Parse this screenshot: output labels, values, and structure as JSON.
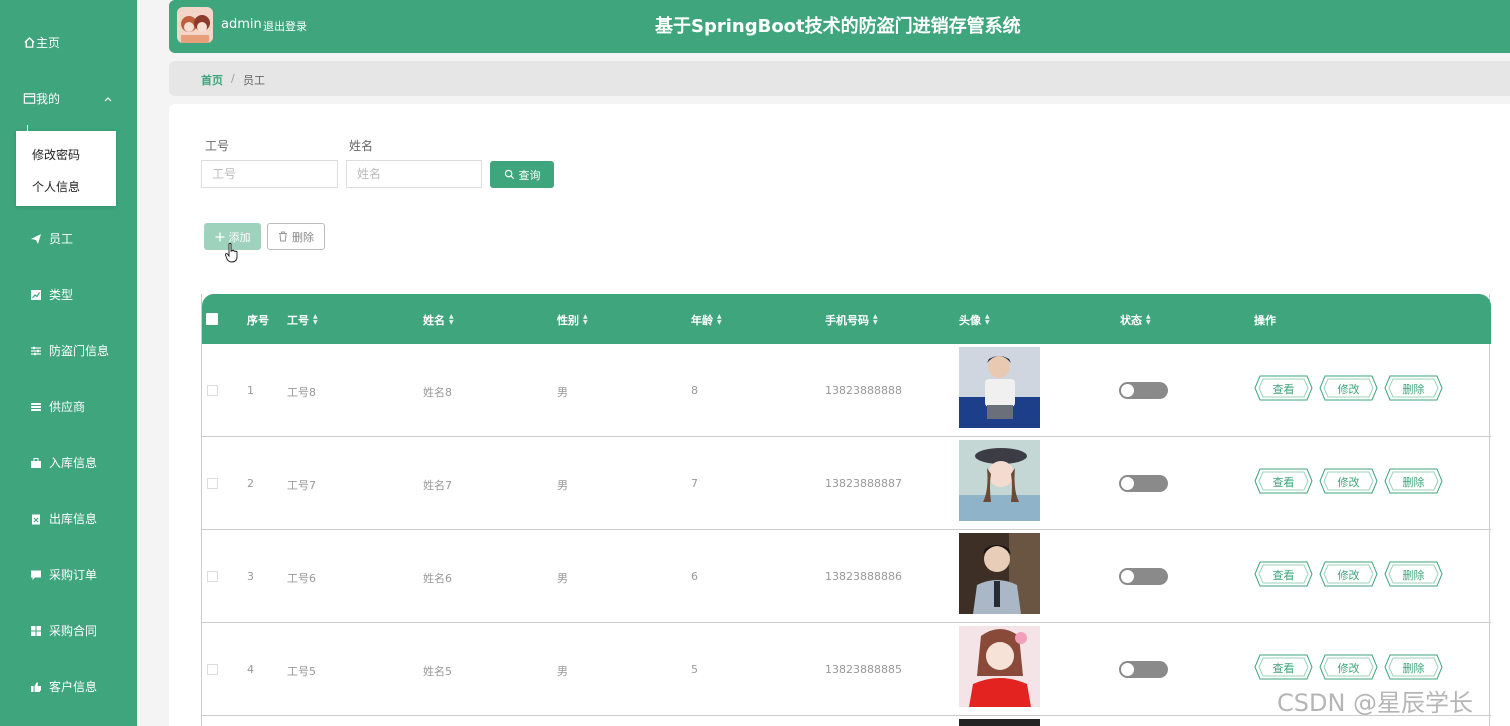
{
  "sidebar": {
    "items": [
      {
        "label": "主页",
        "icon": "home-icon"
      },
      {
        "label": "我的",
        "icon": "window-icon"
      },
      {
        "label": "员工",
        "icon": "send-icon"
      },
      {
        "label": "类型",
        "icon": "chart-icon"
      },
      {
        "label": "防盗门信息",
        "icon": "sliders-icon"
      },
      {
        "label": "供应商",
        "icon": "list-icon"
      },
      {
        "label": "入库信息",
        "icon": "briefcase-icon"
      },
      {
        "label": "出库信息",
        "icon": "clipboard-icon"
      },
      {
        "label": "采购订单",
        "icon": "chat-icon"
      },
      {
        "label": "采购合同",
        "icon": "grid-icon"
      },
      {
        "label": "客户信息",
        "icon": "thumb-icon"
      }
    ],
    "submenu": [
      "修改密码",
      "个人信息"
    ]
  },
  "header": {
    "username": "admin",
    "logout": "退出登录",
    "title": "基于SpringBoot技术的防盗门进销存管系统"
  },
  "breadcrumb": {
    "home": "首页",
    "sep": "/",
    "current": "员工"
  },
  "search": {
    "label_id": "工号",
    "placeholder_id": "工号",
    "label_name": "姓名",
    "placeholder_name": "姓名",
    "query_button": "查询"
  },
  "toolbar": {
    "add": "添加",
    "delete": "删除"
  },
  "table": {
    "headers": [
      "序号",
      "工号",
      "姓名",
      "性别",
      "年龄",
      "手机号码",
      "头像",
      "状态",
      "操作"
    ],
    "actions": [
      "查看",
      "修改",
      "删除"
    ],
    "rows": [
      {
        "no": "1",
        "id": "工号8",
        "name": "姓名8",
        "gender": "男",
        "age": "8",
        "phone": "13823888888"
      },
      {
        "no": "2",
        "id": "工号7",
        "name": "姓名7",
        "gender": "男",
        "age": "7",
        "phone": "13823888887"
      },
      {
        "no": "3",
        "id": "工号6",
        "name": "姓名6",
        "gender": "男",
        "age": "6",
        "phone": "13823888886"
      },
      {
        "no": "4",
        "id": "工号5",
        "name": "姓名5",
        "gender": "男",
        "age": "5",
        "phone": "13823888885"
      }
    ]
  },
  "watermark": "CSDN @星辰学长",
  "colors": {
    "primary": "#3ea57d",
    "light": "#9ed2bd",
    "toggle_off": "#8a8a8a"
  }
}
